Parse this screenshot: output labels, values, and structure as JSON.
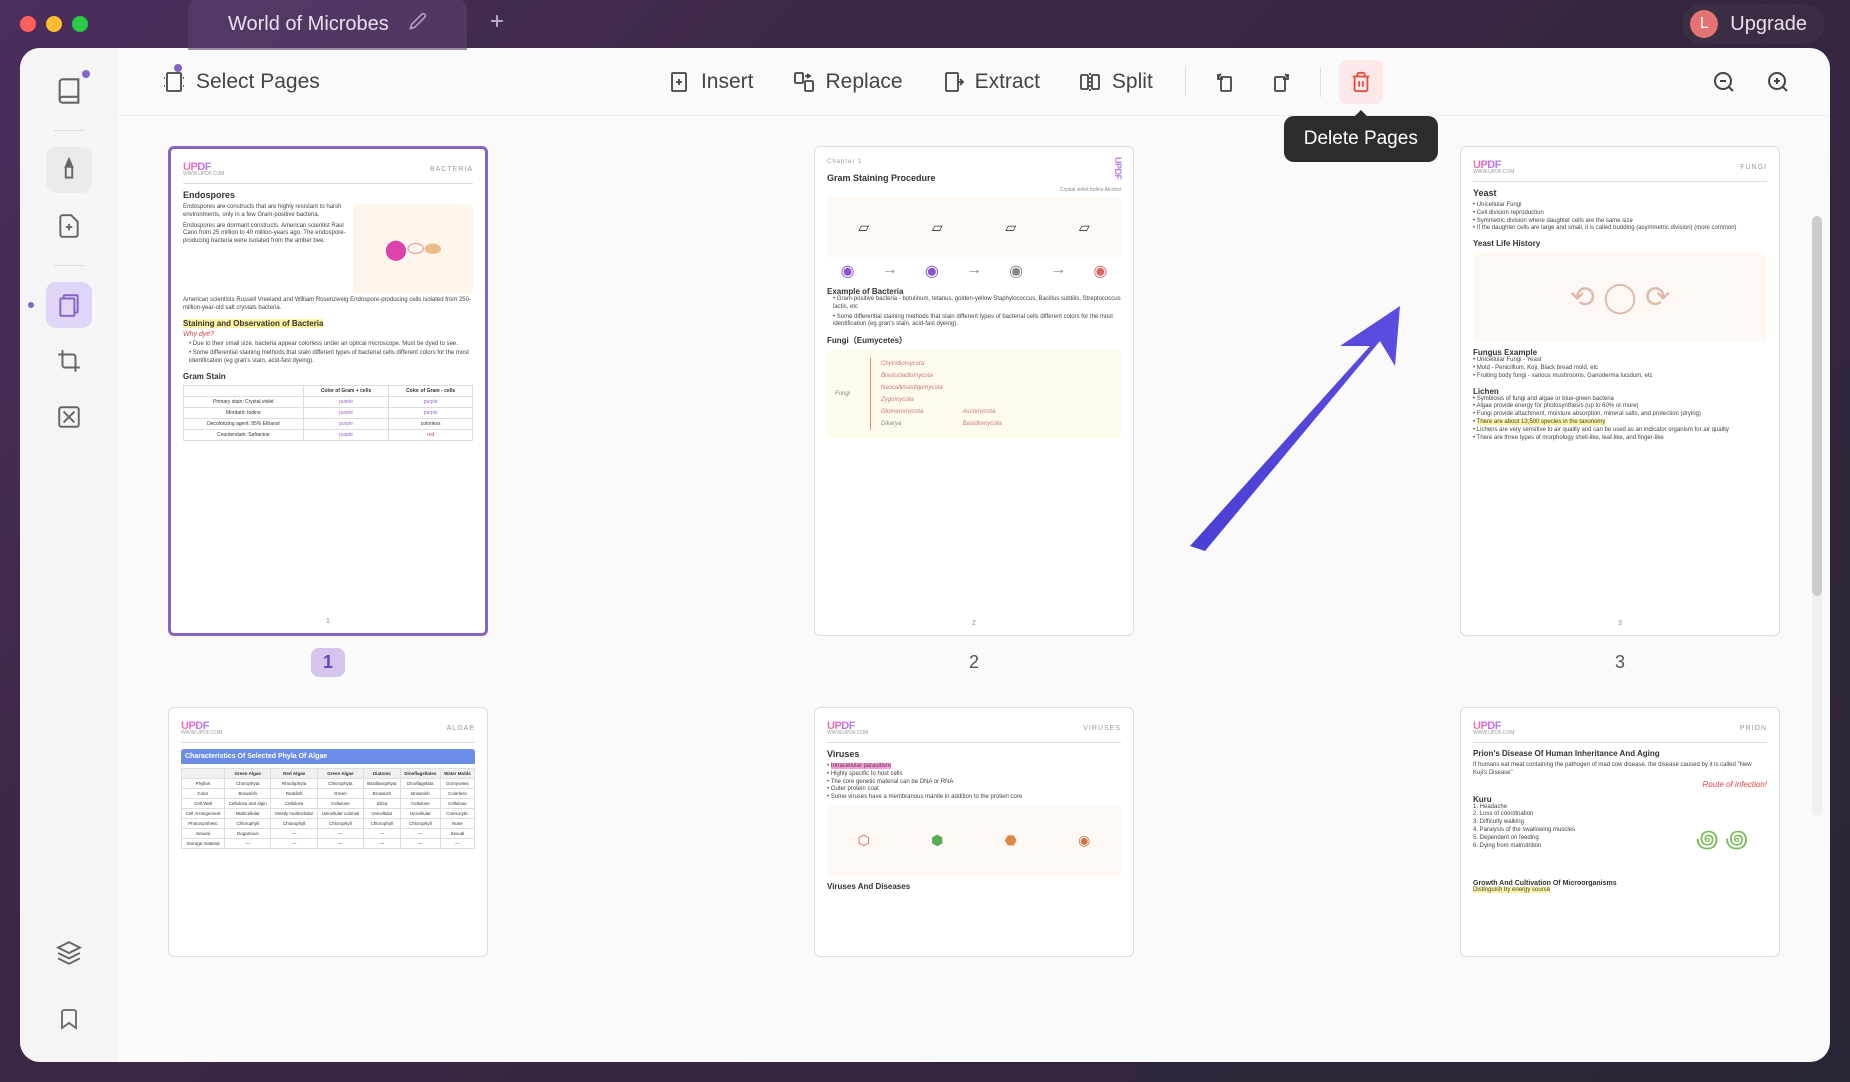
{
  "window": {
    "title": "World of Microbes"
  },
  "header": {
    "avatar_initial": "L",
    "upgrade_label": "Upgrade"
  },
  "toolbar": {
    "select_pages": "Select Pages",
    "insert": "Insert",
    "replace": "Replace",
    "extract": "Extract",
    "split": "Split",
    "tooltip_delete": "Delete Pages"
  },
  "pages": {
    "p1_num": "1",
    "p2_num": "2",
    "p3_num": "3"
  },
  "brand": {
    "logo": "UPDF",
    "sub": "WWW.UPDF.COM"
  },
  "page1": {
    "category": "BACTERIA",
    "title_endospores": "Endospores",
    "text_endo1": "Endospores are constructs that are highly resistant to harsh environments, only in a few Gram-positive bacteria.",
    "text_endo2": "Endospores are dormant constructs. American scientist Raul Cano from 25 million to 40 million-years ago. The endospore-producing bacteria were isolated from the amber bee.",
    "text_endo3": "American scientists Russell Vreeland and William Rosenzweig Endospore-producing cells isolated from 250-million-year-old salt crystals bacteria.",
    "title_staining": "Staining and Observation of Bacteria",
    "why_dye": "Why dye?",
    "bullet1": "Due to their small size, bacteria appear colorless under an optical microscope. Must be dyed to see.",
    "bullet2": "Some differential staining methods that stain different types of bacterial cells different colors for the most identification (eg gran's stain, acid-fast dyeing).",
    "title_gram": "Gram Stain",
    "table_h1": "Color of Gram + cells",
    "table_h2": "Color of Gram - cells",
    "row1": "Primary stain: Crystal violet",
    "row2": "Mordant: Iodine",
    "row3": "Decolorizing agent: 95% Ethanol",
    "row4": "Counterstain: Safranine",
    "purple": "purple",
    "colorless": "colorless",
    "red": "red"
  },
  "page2": {
    "chapter": "Chapter 1",
    "title_gram": "Gram Staining Procedure",
    "legend": "Crystal violet  Iodine  Alcohol  ",
    "title_example": "Example of Bacteria",
    "ex1": "Gram-positive bacteria - botulinum, tetanus, golden-yellow Staphylococcus, Bacillus subtilis, Streptococcus lactis, etc",
    "ex2": "Some differential staining methods that stain different types of bacterial cells different colors for the most identification (eg gran's stain, acid-fast dyeing).",
    "title_fungi": "Fungi（Eumycetes）",
    "fungi_label": "Fungi",
    "f1": "Chytridiomycota",
    "f2": "Blastocladiomycota",
    "f3": "Neocallimastigomycota",
    "f4": "Zygomycota",
    "f5": "Glomeromycota",
    "f6": "Dikarya",
    "f7": "Ascomycota",
    "f8": "Basidiomycota"
  },
  "page3": {
    "category": "FUNGI",
    "yeast_title": "Yeast",
    "y1": "Unicellular Fungi",
    "y2": "Cell division reproduction",
    "y3": "Symmetric division where daughter cells are the same size",
    "y4": "If the daughter cells are large and small, it is called budding (asymmetric division) (more common)",
    "yeast_history": "Yeast Life History",
    "fungus_title": "Fungus Example",
    "fe1": "Unicellular Fungi - Yeast",
    "fe2": "Mold - Penicillium, Koji, Black bread mold, etc",
    "fe3": "Fruiting body fungi - various mushrooms, Ganoderma lucidum, etc",
    "lichen_title": "Lichen",
    "l1": "Symbiosis of fungi and algae or blue-green bacteria",
    "l2": "Algae provide energy for photosynthesis (up to 60% or more)",
    "l3": "Fungi provide attachment, moisture absorption, mineral salts, and protection (drying)",
    "l4": "There are about 13,500 species in the taxonomy",
    "l5": "Lichens are very sensitive to air quality and can be used as an indicator organism for air quality",
    "l6": "There are three types of morphology shell-like, leaf-like, and finger-like"
  },
  "page4": {
    "category": "ALGAE",
    "title": "Characteristics Of Selected Phyla Of Algae"
  },
  "page5": {
    "category": "VIRUSES",
    "title_viruses": "Viruses",
    "v1": "Intracellular parasitism",
    "v2": "Highly specific to host cells",
    "v3": "The core genetic material can be DNA or RNA",
    "v4": "Outer protein coat",
    "v5": "Some viruses have a membranous mantle in addition to the protein core",
    "title_diseases": "Viruses And Diseases"
  },
  "page6": {
    "category": "PRION",
    "title_prion": "Prion's Disease Of Human Inheritance And Aging",
    "pr1": "If humans eat meat containing the pathogen of mad cow disease, the disease caused by it is called \"New Kuji's Disease\"",
    "route": "Route of infection!",
    "kuru_title": "Kuru",
    "k1": "1. Headache",
    "k2": "2. Loss of coordination",
    "k3": "3. Difficulty walking",
    "k4": "4. Paralysis of the swallowing muscles",
    "k5": "5. Dependent on feeding",
    "k6": "6. Dying from malnutrition",
    "growth_title": "Growth And Cultivation Of Microorganisms",
    "distinguish": "Distinguish by energy source"
  }
}
